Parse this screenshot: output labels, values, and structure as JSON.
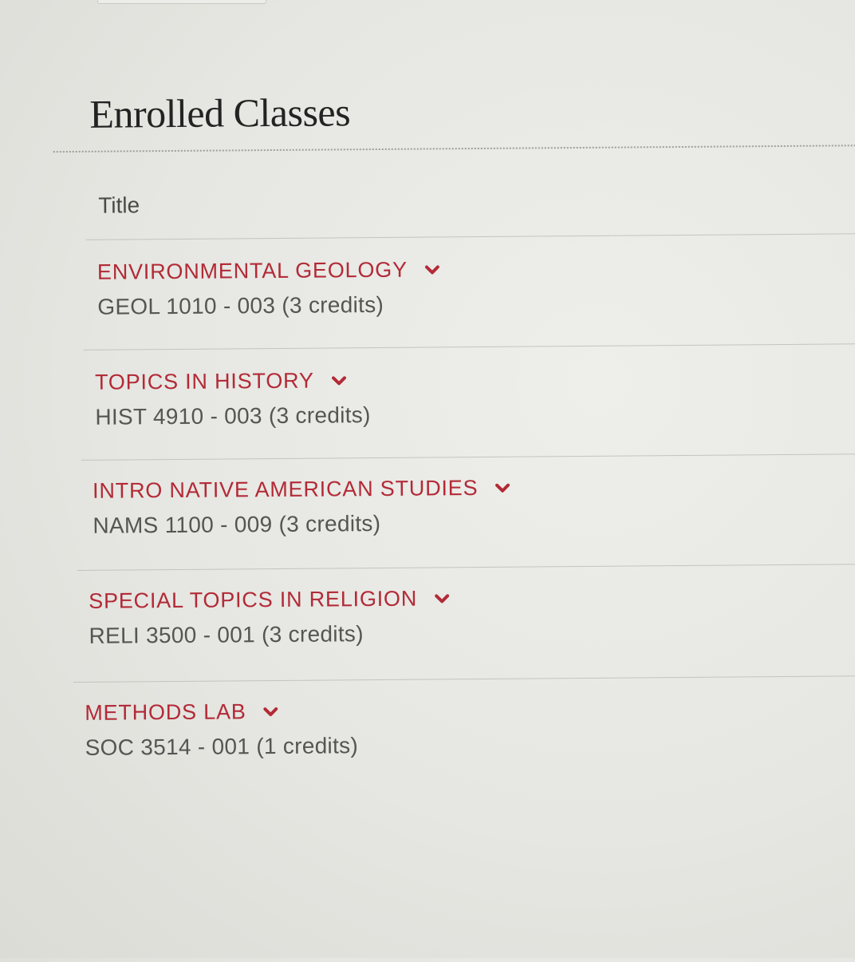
{
  "page": {
    "section_title": "Enrolled Classes",
    "column_header": "Title"
  },
  "classes": [
    {
      "title": "ENVIRONMENTAL GEOLOGY",
      "detail": "GEOL 1010 - 003 (3 credits)",
      "expand_icon": "chevron-down"
    },
    {
      "title": "TOPICS IN HISTORY",
      "detail": "HIST 4910 - 003 (3 credits)",
      "expand_icon": "chevron-down"
    },
    {
      "title": "INTRO NATIVE AMERICAN STUDIES",
      "detail": "NAMS 1100 - 009 (3 credits)",
      "expand_icon": "chevron-down"
    },
    {
      "title": "SPECIAL TOPICS IN RELIGION",
      "detail": "RELI 3500 - 001 (3 credits)",
      "expand_icon": "chevron-down"
    },
    {
      "title": "METHODS LAB",
      "detail": "SOC 3514 - 001 (1 credits)",
      "expand_icon": "chevron-down"
    }
  ],
  "colors": {
    "accent": "#b22a36",
    "heading": "#232323",
    "body_text": "#555553"
  }
}
